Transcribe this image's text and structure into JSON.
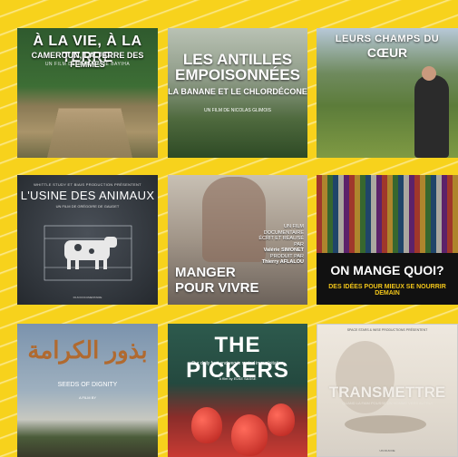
{
  "tiles": [
    {
      "title": "À LA VIE, À LA TERRE",
      "subtitle": "CAMEROUN, LA TERRE DES FEMMES",
      "tiny": "UN FILM DE JEAN-MARIE BAYIHA"
    },
    {
      "title": "LES ANTILLES EMPOISONNÉES",
      "subtitle": "LA BANANE ET LE CHLORDÉCONE",
      "tiny": "UN FILM DE NICOLAS GLIMOIS"
    },
    {
      "title": "LEURS CHAMPS DU",
      "title2": "CŒUR"
    },
    {
      "tiny": "WHITTLE STUDY ET BIAIS PRODUCTION PRÉSENTENT",
      "title": "L'USINE DES ANIMAUX",
      "tiny2": "UN FILM DE GRÉGOIRE DE GAUDET",
      "tiny3": "FILM DOCUMENTAIRE"
    },
    {
      "title_line1": "MANGER",
      "title_line2": "POUR VIVRE",
      "info_line1": "UN FILM DOCUMENTAIRE",
      "info_line2": "ÉCRIT ET RÉALISÉ PAR",
      "info_line3": "Valérie SIMONET",
      "info_line4": "PRODUIT PAR",
      "info_line5": "Thierry AFLALOU"
    },
    {
      "title": "ON MANGE QUOI?",
      "subtitle": "DES IDÉES POUR MIEUX SE NOURRIR DEMAIN"
    },
    {
      "title": "بذور الكرامة",
      "subtitle": "SEEDS OF DIGNITY",
      "tiny": "A FILM BY"
    },
    {
      "title": "THE PICKERS",
      "subtitle": "Our daily fruit and veg is rooted in exploitation",
      "tiny": "A film by ELKE SASSE"
    },
    {
      "tiny": "SPACE STARS & WISE PRODUCTIONS PRÉSENTENT",
      "title": "TRANSMETTRE",
      "subtitle": "QUAND LA FAIM POUSSE UN HOMME VERS AUTRUI",
      "tiny2": "UN FILM DE"
    }
  ]
}
